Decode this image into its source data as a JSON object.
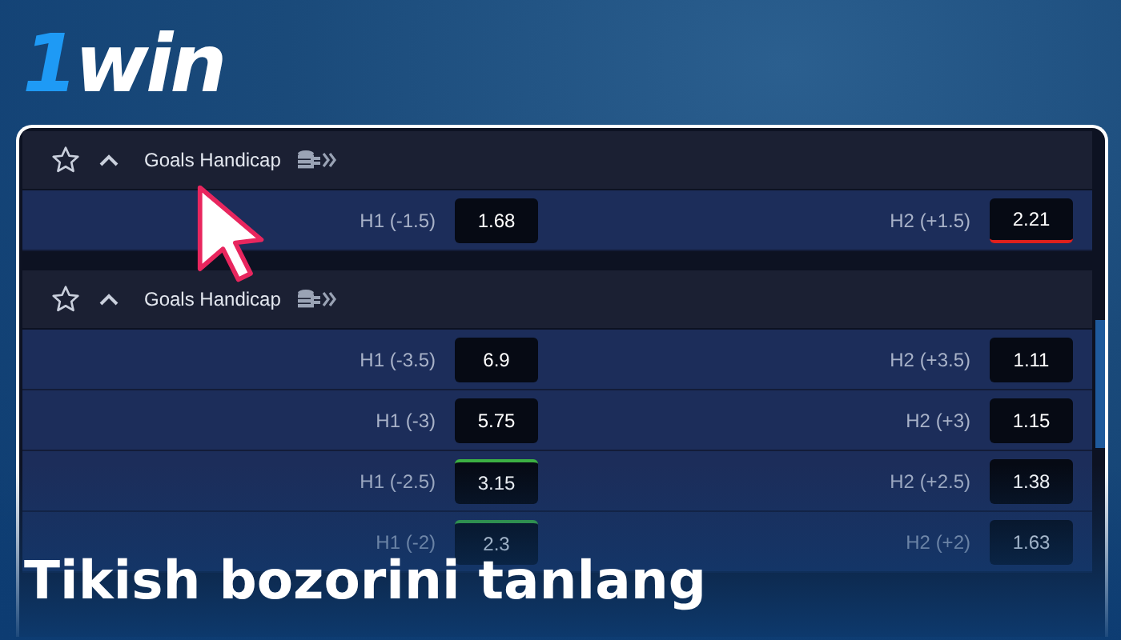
{
  "logo": {
    "digit": "1",
    "word": "win"
  },
  "markets": [
    {
      "title": "Goals Handicap",
      "starred": false,
      "expanded": true,
      "rows": [
        {
          "left": {
            "label": "H1 (-1.5)",
            "odds": "1.68",
            "rising": false,
            "falling": false
          },
          "right": {
            "label": "H2 (+1.5)",
            "odds": "2.21",
            "rising": false,
            "falling": true
          }
        }
      ]
    },
    {
      "title": "Goals Handicap",
      "starred": false,
      "expanded": true,
      "rows": [
        {
          "left": {
            "label": "H1 (-3.5)",
            "odds": "6.9",
            "rising": false,
            "falling": false
          },
          "right": {
            "label": "H2 (+3.5)",
            "odds": "1.11",
            "rising": false,
            "falling": false
          }
        },
        {
          "left": {
            "label": "H1 (-3)",
            "odds": "5.75",
            "rising": false,
            "falling": false
          },
          "right": {
            "label": "H2 (+3)",
            "odds": "1.15",
            "rising": false,
            "falling": false
          }
        },
        {
          "left": {
            "label": "H1 (-2.5)",
            "odds": "3.15",
            "rising": true,
            "falling": false
          },
          "right": {
            "label": "H2 (+2.5)",
            "odds": "1.38",
            "rising": false,
            "falling": false
          }
        },
        {
          "left": {
            "label": "H1 (-2)",
            "odds": "2.3",
            "rising": true,
            "falling": false
          },
          "right": {
            "label": "H2 (+2)",
            "odds": "1.63",
            "rising": false,
            "falling": false
          }
        }
      ]
    }
  ],
  "caption": "Tikish bozorini tanlang"
}
